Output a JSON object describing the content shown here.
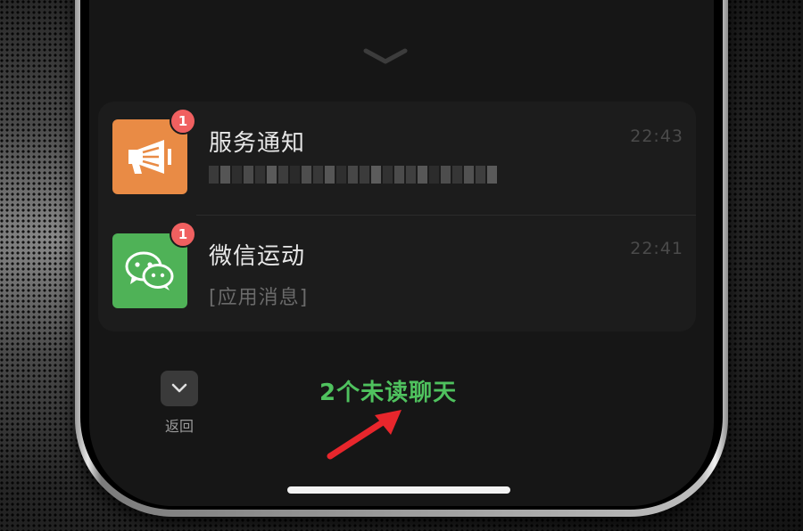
{
  "notifications": [
    {
      "title": "服务通知",
      "time": "22:43",
      "badge": "1",
      "icon": "megaphone-icon",
      "color": "#e98b45",
      "subtitle_obscured": true
    },
    {
      "title": "微信运动",
      "time": "22:41",
      "badge": "1",
      "icon": "wechat-icon",
      "color": "#4fb257",
      "subtitle": "[应用消息]"
    }
  ],
  "footer": {
    "back_label": "返回",
    "unread_text": "2个未读聊天",
    "unread_color": "#4fc25e"
  },
  "annotation_arrow_color": "#e8262c"
}
